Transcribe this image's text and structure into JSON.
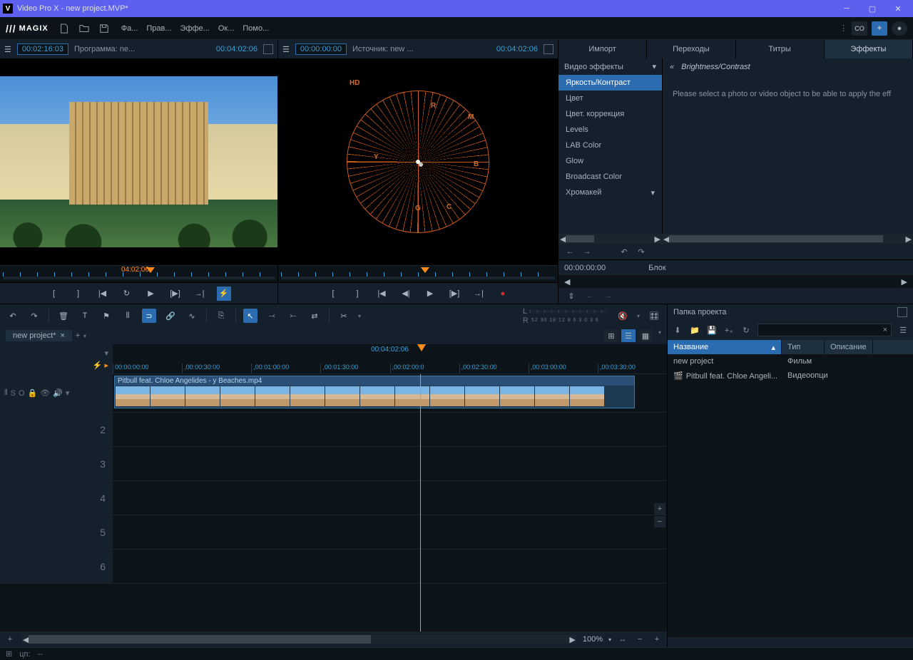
{
  "titlebar": {
    "app_icon": "V",
    "title": "Video Pro X - new project.MVP*"
  },
  "menubar": {
    "logo": "MAGIX",
    "items": [
      "Фа...",
      "Прав...",
      "Эффе...",
      "Ок...",
      "Помо..."
    ]
  },
  "monitors": {
    "program": {
      "tc_in": "00:02:16:03",
      "label": "Программа: ne...",
      "tc_out": "00:04:02:06",
      "scrub_label": "04:02:06"
    },
    "source": {
      "tc_in": "00:00:00:00",
      "label": "Источник: new ...",
      "tc_out": "00:04:02:06",
      "hd_label": "HD",
      "scope_labels": [
        "R",
        "M",
        "B",
        "C",
        "G",
        "Y"
      ]
    }
  },
  "rightpanel": {
    "tabs": [
      "Импорт",
      "Переходы",
      "Титры",
      "Эффекты"
    ],
    "active_tab": 3,
    "fx_category": "Видео эффекты",
    "fx_list": [
      "Яркость/Контраст",
      "Цвет",
      "Цвет. коррекция",
      "Levels",
      "LAB Color",
      "Glow",
      "Broadcast Color",
      "Хромакей"
    ],
    "fx_selected": 0,
    "fx_title": "Brightness/Contrast",
    "fx_message": "Please select a photo or video object to be able to apply the eff",
    "fx_time": "00:00:00:00",
    "fx_block": "Блок"
  },
  "timeline": {
    "project_tab": "new project*",
    "duration": "00:04:02:06",
    "ruler_ticks": [
      "00:00:00:00",
      ",00:00:30:00",
      ",00:01:00:00",
      ",00:01:30:00",
      ",00:02:00:0",
      ",00:02:30:00",
      ",00:03:00:00",
      ",00:03:30:00"
    ],
    "clip_name": "Pitbull feat. Chloe Angelides - y Beaches.mp4",
    "track_nums": [
      "2",
      "3",
      "4",
      "5",
      "6"
    ],
    "meter_labels": {
      "L": "L",
      "R": "R",
      "ticks": "52  30  18  12  8   6   3   0   3   6"
    },
    "zoom": "100%",
    "track1_icons": [
      "S",
      "O",
      "🔒",
      "👁",
      "🔊",
      "▾"
    ]
  },
  "project": {
    "title": "Папка проекта",
    "cols": {
      "name": "Название",
      "type": "Тип",
      "desc": "Описание"
    },
    "rows": [
      {
        "name": "new project",
        "type": "Фильм"
      },
      {
        "name": "Pitbull feat. Chloe Angeli...",
        "type": "Видеоопци",
        "icon": "🎬"
      }
    ]
  },
  "statusbar": {
    "label": "цп:",
    "value": "--"
  }
}
